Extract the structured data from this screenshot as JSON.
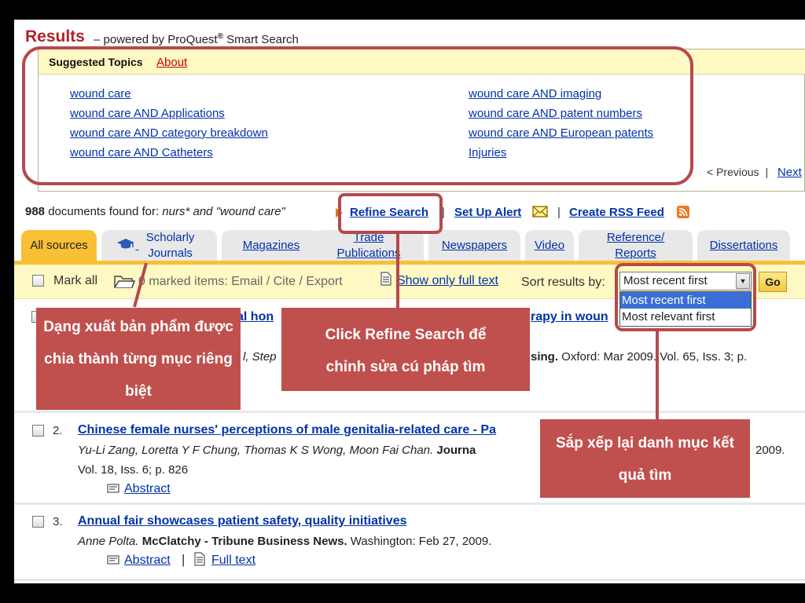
{
  "header": {
    "title": "Results",
    "powered_by": "– powered by ProQuest",
    "reg_mark": "®",
    "powered_tail": " Smart Search"
  },
  "suggested_topics": {
    "title": "Suggested Topics",
    "about_link": "About",
    "left_column": [
      "wound care",
      "wound care AND Applications",
      "wound care AND category breakdown",
      "wound care AND Catheters"
    ],
    "right_column": [
      "wound care AND imaging",
      "wound care AND patent numbers",
      "wound care AND European patents",
      "Injuries"
    ],
    "previous": "< Previous",
    "divider": "|",
    "next": "Next"
  },
  "search_info": {
    "count": "988",
    "found_text": "documents found for:",
    "query": "nurs* and \"wound care\"",
    "refine_search": "Refine Search",
    "set_up_alert": "Set Up Alert",
    "create_rss": "Create RSS Feed",
    "separator": "|"
  },
  "tabs": [
    {
      "label": "All sources",
      "active": true
    },
    {
      "label": "Scholarly Journals",
      "active": false
    },
    {
      "label": "Magazines",
      "active": false
    },
    {
      "label": "Trade Publications",
      "active": false
    },
    {
      "label": "Newspapers",
      "active": false
    },
    {
      "label": "Video",
      "active": false
    },
    {
      "label": "Reference/ Reports",
      "active": false
    },
    {
      "label": "Dissertations",
      "active": false
    }
  ],
  "toolbar": {
    "mark_all": "Mark all",
    "marked_items": "0 marked items: Email / Cite / Export",
    "show_full_text": "Show only full text",
    "sort_label": "Sort results by:",
    "sort_selected": "Most recent first",
    "sort_options": [
      "Most recent first",
      "Most relevant first"
    ],
    "go": "Go"
  },
  "results": [
    {
      "number": "1.",
      "title_visible_part": "al hon",
      "title_tail": "rapy in woun",
      "authors_fragment": "l, Step",
      "source_fragment": "sing.",
      "details_fragment": " Oxford: Mar 2009. Vol. 65, Iss. 3; p."
    },
    {
      "number": "2.",
      "title": "Chinese female nurses' perceptions of male genitalia-related care - Pa",
      "authors": "Yu-Li Zang, Loretta Y F Chung, Thomas K S Wong, Moon Fai Chan.",
      "source": "Journa",
      "year_tail": "2009.",
      "details": "Vol. 18, Iss. 6; p. 826",
      "abstract": "Abstract"
    },
    {
      "number": "3.",
      "title": "Annual fair showcases patient safety, quality initiatives",
      "authors": "Anne Polta.",
      "source": "McClatchy - Tribune Business News.",
      "details": " Washington: Feb 27, 2009.",
      "abstract": "Abstract",
      "full_text": "Full text",
      "divider": "|"
    }
  ],
  "annotations": {
    "tabs_note": "Dạng xuất bản phẩm được chia thành từng mục riêng biệt",
    "refine_note": "Click Refine Search để chỉnh sửa cú pháp tìm",
    "sort_note": "Sắp xếp lại danh mục kết quả tìm"
  },
  "colors": {
    "accent_red": "#b0232b",
    "link_blue": "#0033aa",
    "tab_active": "#f9bf35",
    "topic_header_bg": "#fff9c4",
    "callout_bg": "#c0504d",
    "dropdown_highlight": "#3a6fd8"
  },
  "icons": [
    "graduation-cap-icon",
    "envelope-icon",
    "rss-icon",
    "folder-icon",
    "document-icon",
    "abstract-icon",
    "full-text-icon",
    "dropdown-arrow-icon"
  ]
}
